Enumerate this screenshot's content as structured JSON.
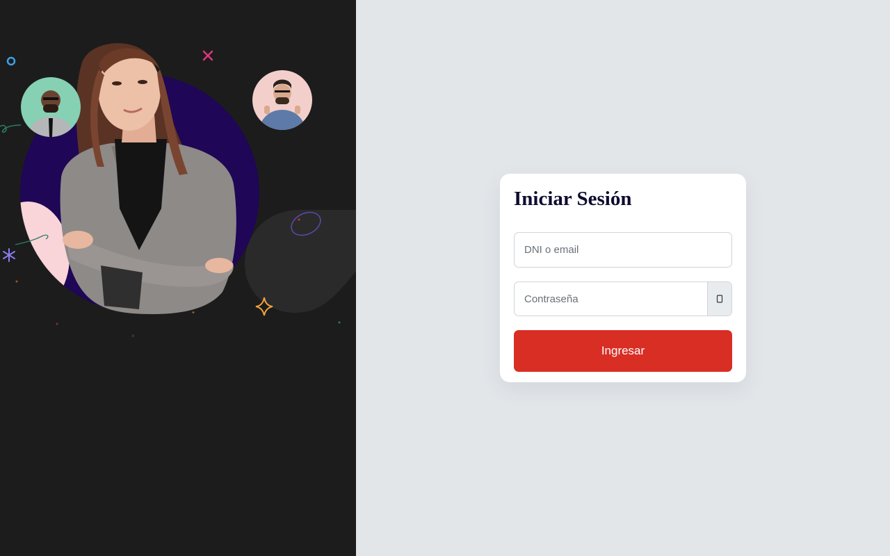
{
  "login": {
    "title": "Iniciar Sesión",
    "email_placeholder": "DNI o email",
    "password_placeholder": "Contraseña",
    "submit_label": "Ingresar"
  },
  "icons": {
    "password_toggle": "eye-icon"
  },
  "colors": {
    "left_background": "#1c1c1c",
    "right_background": "#e3e6e9",
    "title": "#0e0b2f",
    "primary_button": "#d92e24",
    "hero_circle": "#1f0656"
  }
}
